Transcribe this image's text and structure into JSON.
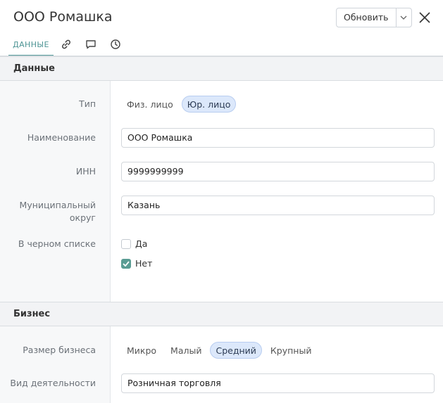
{
  "header": {
    "title": "ООО Ромашка",
    "refresh_label": "Обновить"
  },
  "tabs": [
    {
      "label": "ДАННЫЕ",
      "active": true
    },
    {
      "icon": "link-icon"
    },
    {
      "icon": "comment-icon"
    },
    {
      "icon": "history-clock-icon"
    }
  ],
  "sections": {
    "data": {
      "title": "Данные",
      "type": {
        "label": "Тип",
        "options": [
          "Физ. лицо",
          "Юр. лицо"
        ],
        "selected": "Юр. лицо"
      },
      "name": {
        "label": "Наименование",
        "value": "ООО Ромашка"
      },
      "inn": {
        "label": "ИНН",
        "value": "9999999999"
      },
      "district": {
        "label": "Муниципальный округ",
        "value": "Казань"
      },
      "blacklist": {
        "label": "В черном списке",
        "options": [
          {
            "label": "Да",
            "checked": false
          },
          {
            "label": "Нет",
            "checked": true
          }
        ]
      }
    },
    "business": {
      "title": "Бизнес",
      "size": {
        "label": "Размер бизнеса",
        "options": [
          "Микро",
          "Малый",
          "Средний",
          "Крупный"
        ],
        "selected": "Средний"
      },
      "activity": {
        "label": "Вид деятельности",
        "value": "Розничная торговля"
      }
    }
  },
  "colors": {
    "accent": "#4f9595",
    "checkbox": "#5a9c93",
    "selected_pill": "#dce8fb"
  }
}
